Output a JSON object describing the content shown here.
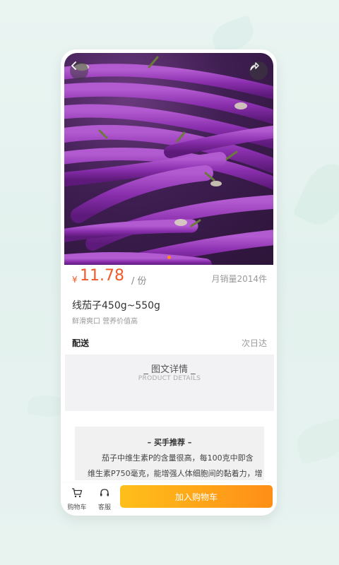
{
  "product": {
    "price_symbol": "¥",
    "price": "11.78",
    "unit": "/ 份",
    "monthly_sales": "月销量2014件",
    "name": "线茄子450g~550g",
    "description": "鲜滑爽口 营养价值高"
  },
  "delivery": {
    "label": "配送",
    "value": "次日达"
  },
  "details": {
    "title": "_ 图文详情 _",
    "subtitle": "PRODUCT DETAILS"
  },
  "recommendation": {
    "title": "– 买手推荐 –",
    "line1": "茄子中维生素P的含量很高，每100克中即含",
    "line2": "维生素P750毫克，能增强人体细胞间的黏着力，增"
  },
  "bottom_bar": {
    "cart_label": "购物车",
    "service_label": "客服",
    "add_to_cart_label": "加入购物车"
  },
  "icons": {
    "back": "chevron-left-icon",
    "share": "share-icon",
    "cart": "cart-icon",
    "service": "headset-icon"
  },
  "colors": {
    "price": "#f05a28",
    "button_start": "#ffbf1a",
    "button_end": "#ff8e17"
  }
}
